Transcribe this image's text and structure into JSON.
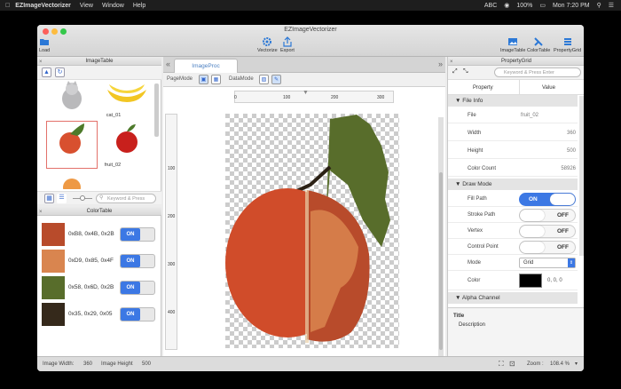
{
  "menubar": {
    "apple": "",
    "app_name": "EZImageVectorizer",
    "menus": [
      "View",
      "Window",
      "Help"
    ],
    "battery": "100%",
    "clock": "Mon 7:20 PM",
    "input_source": "ABC"
  },
  "window": {
    "title": "EZImageVectorizer",
    "toolbar": {
      "load": "Load",
      "vectorize": "Vectorize",
      "export": "Export",
      "image_table": "ImageTable",
      "color_table": "ColorTable",
      "property_grid": "PropertyGrid"
    }
  },
  "image_table": {
    "title": "ImageTable",
    "items": [
      {
        "label": "cat_01"
      },
      {
        "label": "fruit_04"
      },
      {
        "label": "fruit_02"
      },
      {
        "label": "fruit_03"
      }
    ],
    "search_placeholder": "Keyword & Press"
  },
  "color_table": {
    "title": "ColorTable",
    "rows": [
      {
        "color": "#B84B2B",
        "label": "0xB8, 0x4B, 0x2B",
        "state": "ON"
      },
      {
        "color": "#D9854F",
        "label": "0xD9, 0x85, 0x4F",
        "state": "ON"
      },
      {
        "color": "#586D2B",
        "label": "0x58, 0x6D, 0x2B",
        "state": "ON"
      },
      {
        "color": "#35291B",
        "label": "0x35, 0x29, 0x05",
        "state": "ON"
      }
    ]
  },
  "center": {
    "tab_label": "ImageProc",
    "page_mode": "PageMode",
    "data_mode": "DataMode",
    "ruler_h": [
      "0",
      "100",
      "200",
      "300"
    ],
    "ruler_v": [
      "100",
      "200",
      "300",
      "400"
    ]
  },
  "property_grid": {
    "title": "PropertyGrid",
    "search_placeholder": "Keyword & Press Enter",
    "col_property": "Property",
    "col_value": "Value",
    "sections": {
      "file_info": "File Info",
      "draw_mode": "Draw Mode",
      "alpha_channel": "Alpha Channel"
    },
    "file_info": {
      "file_k": "File",
      "file_v": "fruit_02",
      "width_k": "Width",
      "width_v": "360",
      "height_k": "Height",
      "height_v": "500",
      "cc_k": "Color Count",
      "cc_v": "58926"
    },
    "draw_mode": {
      "fill_k": "Fill Path",
      "fill_v": "ON",
      "stroke_k": "Stroke Path",
      "stroke_v": "OFF",
      "vertex_k": "Vertex",
      "vertex_v": "OFF",
      "cp_k": "Control Point",
      "cp_v": "OFF",
      "mode_k": "Mode",
      "mode_v": "Grid",
      "color_k": "Color",
      "color_v": "0, 0, 0"
    },
    "desc_title": "Title",
    "desc_text": "Description"
  },
  "status": {
    "w_label": "Image Width:",
    "w_val": "360",
    "h_label": "Image Height",
    "h_val": "500",
    "zoom_label": "Zoom :",
    "zoom_val": "108.4 %"
  },
  "colors": {
    "accent": "#3C78E4",
    "peach_dark": "#B84B2B",
    "peach_light": "#D9854F",
    "leaf": "#586D2B"
  }
}
